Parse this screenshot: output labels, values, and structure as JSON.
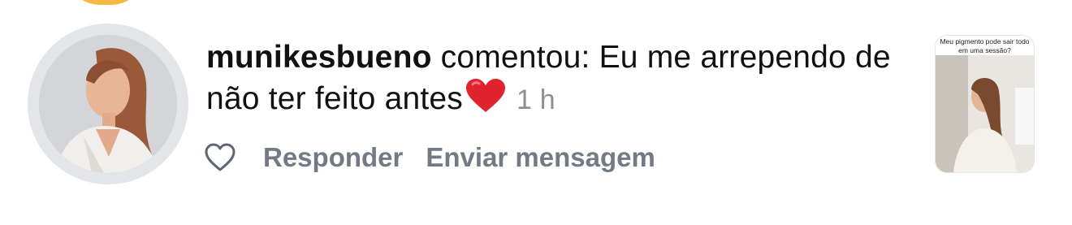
{
  "notification": {
    "username": "munikesbueno",
    "action_text": " comentou: Eu me arrependo de não ter feito antes",
    "time": "1 h",
    "emoji": "red-heart",
    "reply_label": "Responder",
    "message_label": "Enviar mensagem",
    "post_caption": "Meu pigmento pode sair todo em uma sessão?"
  },
  "colors": {
    "primary_text": "#111111",
    "secondary_text": "#737a85",
    "time_text": "#8e8e93",
    "avatar_ring": "#e3e5e8",
    "story_ring": "#f5b942",
    "heart": "#e0242d"
  },
  "icons": {
    "like": "heart-outline-icon"
  }
}
